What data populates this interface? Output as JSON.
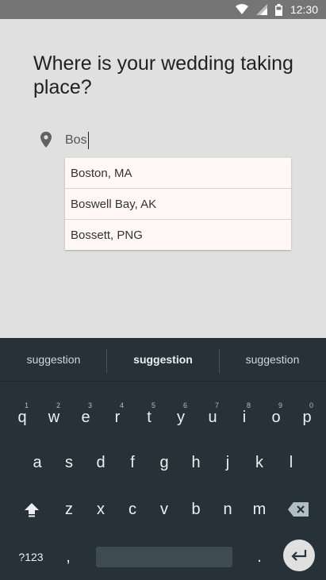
{
  "status_bar": {
    "time": "12:30",
    "icons": [
      "wifi-icon",
      "cell-signal-icon",
      "battery-icon"
    ]
  },
  "page": {
    "title": "Where is your wedding taking place?"
  },
  "location": {
    "icon": "location-pin-icon",
    "value": "Bos"
  },
  "suggestions": [
    "Boston, MA",
    "Boswell Bay, AK",
    "Bossett, PNG"
  ],
  "keyboard": {
    "suggestion_bar": [
      "suggestion",
      "suggestion",
      "suggestion"
    ],
    "row1": [
      {
        "key": "q",
        "num": "1"
      },
      {
        "key": "w",
        "num": "2"
      },
      {
        "key": "e",
        "num": "3"
      },
      {
        "key": "r",
        "num": "4"
      },
      {
        "key": "t",
        "num": "5"
      },
      {
        "key": "y",
        "num": "6"
      },
      {
        "key": "u",
        "num": "7"
      },
      {
        "key": "i",
        "num": "8"
      },
      {
        "key": "o",
        "num": "9"
      },
      {
        "key": "p",
        "num": "0"
      }
    ],
    "row2": [
      "a",
      "s",
      "d",
      "f",
      "g",
      "h",
      "j",
      "k",
      "l"
    ],
    "row3": [
      "z",
      "x",
      "c",
      "v",
      "b",
      "n",
      "m"
    ],
    "symbols_label": "?123",
    "comma": ",",
    "period": "."
  }
}
